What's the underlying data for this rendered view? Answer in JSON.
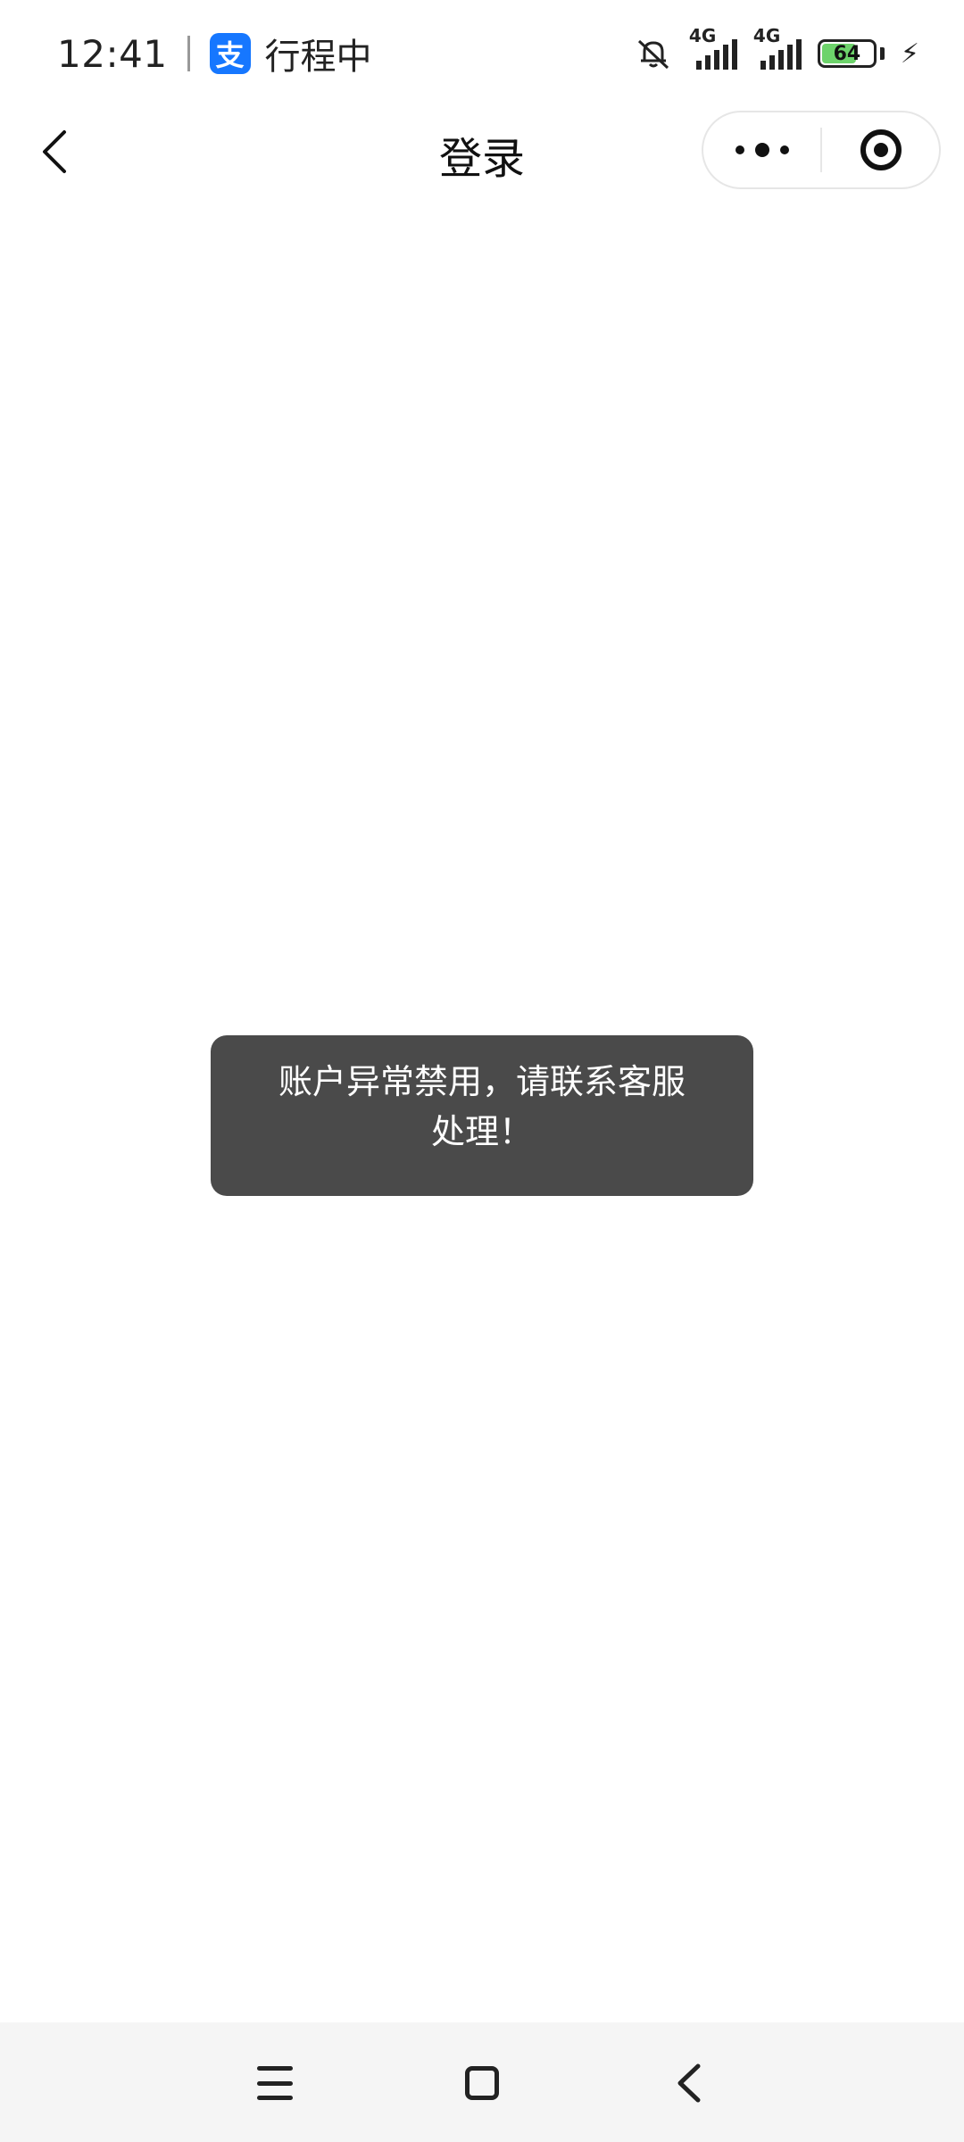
{
  "status_bar": {
    "time": "12:41",
    "app_icon_label": "支",
    "trip_text": "行程中",
    "signal1_label": "4G",
    "signal2_label": "4G",
    "battery_level": "64"
  },
  "nav": {
    "title": "登录"
  },
  "toast": {
    "message_line1": "账户异常禁用，请联系客服",
    "message_line2": "处理！"
  },
  "icons": {
    "back": "back-chevron",
    "more": "more-dots",
    "target": "target-circle",
    "menu": "menu-lines",
    "home": "home-square",
    "system_back": "back-chevron"
  }
}
